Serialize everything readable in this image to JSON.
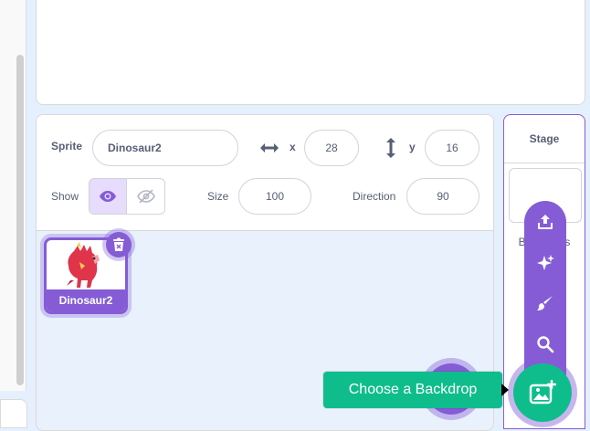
{
  "sprite_info": {
    "sprite_label": "Sprite",
    "sprite_name": "Dinosaur2",
    "x_label": "x",
    "x_value": "28",
    "y_label": "y",
    "y_value": "16",
    "show_label": "Show",
    "visible": true,
    "size_label": "Size",
    "size_value": "100",
    "direction_label": "Direction",
    "direction_value": "90"
  },
  "sprites": [
    {
      "name": "Dinosaur2",
      "selected": true
    }
  ],
  "stage": {
    "title": "Stage",
    "backdrops_label": "Backdrops"
  },
  "backdrop_menu": {
    "items": [
      "upload-icon",
      "surprise-icon",
      "paint-icon",
      "search-icon"
    ],
    "main_icon": "image-add-icon",
    "tooltip": "Choose a Backdrop"
  },
  "colors": {
    "accent": "#855cd6",
    "green": "#0fbd8c",
    "text": "#575e75",
    "panel_bg": "#e9f1fc"
  }
}
